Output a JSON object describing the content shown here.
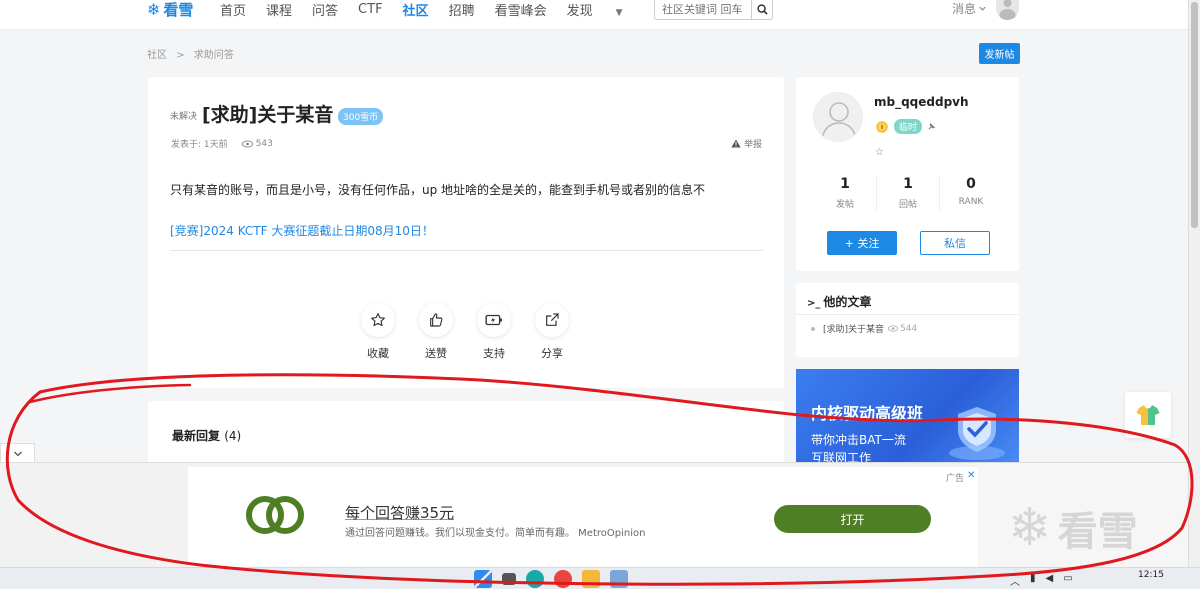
{
  "nav": {
    "logo_text": "看雪",
    "items": [
      "首页",
      "课程",
      "问答",
      "CTF",
      "社区",
      "招聘",
      "看雪峰会",
      "发现"
    ],
    "active_index": 4,
    "search_placeholder": "社区关键词 回车",
    "messages_label": "消息"
  },
  "breadcrumb": {
    "root": "社区",
    "sep": ">",
    "current": "求助问答"
  },
  "new_post_label": "发新帖",
  "post": {
    "status": "未解决",
    "title": "[求助]关于某音",
    "coin_badge": "300雪币",
    "posted_label": "发表于: 1天前",
    "views": "543",
    "report_label": "举报",
    "body": "只有某音的账号，而且是小号，没有任何作品，up 地址啥的全是关的，能查到手机号或者别的信息不",
    "link_text": "[竞赛]2024 KCTF 大赛征题截止日期08月10日！",
    "actions": [
      {
        "label": "收藏",
        "icon": "star-icon"
      },
      {
        "label": "送赞",
        "icon": "thumbs-up-icon"
      },
      {
        "label": "支持",
        "icon": "battery-charge-icon"
      },
      {
        "label": "分享",
        "icon": "share-icon"
      }
    ]
  },
  "replies": {
    "title": "最新回复",
    "count": "(4)"
  },
  "user": {
    "name": "mb_qqeddpvh",
    "badge": "临时",
    "star": "☆",
    "stats": [
      {
        "num": "1",
        "label": "发帖"
      },
      {
        "num": "1",
        "label": "回帖"
      },
      {
        "num": "0",
        "label": "RANK"
      }
    ],
    "follow_label": "+ 关注",
    "pm_label": "私信"
  },
  "articles": {
    "title": "他的文章",
    "items": [
      {
        "title": "[求助]关于某音",
        "views": "544"
      }
    ]
  },
  "promo": {
    "title": "内核驱动高级班",
    "line1": "带你冲击BAT一流",
    "line2": "互联网工作"
  },
  "ad": {
    "label": "广告",
    "close": "✕",
    "title": "每个回答赚35元",
    "desc": "通过回答问题赚钱。我们以现金支付。简单而有趣。 MetroOpinion",
    "button": "打开",
    "brand_color": "#4f7f24"
  },
  "watermark_text": "看雪",
  "taskbar": {
    "clock": "12:15"
  },
  "colors": {
    "accent": "#1e88e5",
    "annotation": "#e0191e"
  }
}
